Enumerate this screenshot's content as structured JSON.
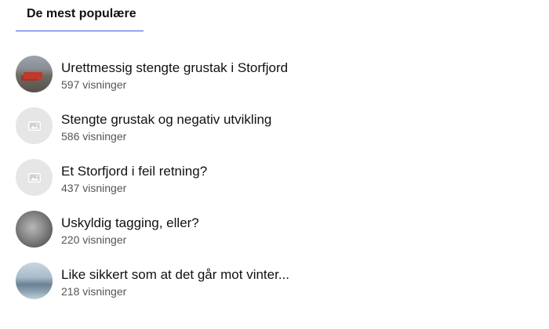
{
  "header": {
    "tab_label": "De mest populære"
  },
  "items": [
    {
      "title": "Urettmessig stengte grustak i Storfjord",
      "views": "597 visninger",
      "thumbnail": "photo"
    },
    {
      "title": "Stengte grustak og negativ utvikling",
      "views": "586 visninger",
      "thumbnail": "image-placeholder-icon"
    },
    {
      "title": "Et Storfjord i feil retning?",
      "views": "437 visninger",
      "thumbnail": "image-placeholder-icon"
    },
    {
      "title": "Uskyldig tagging, eller?",
      "views": "220 visninger",
      "thumbnail": "photo"
    },
    {
      "title": "Like sikkert som at det går mot vinter...",
      "views": "218 visninger",
      "thumbnail": "photo"
    }
  ],
  "colors": {
    "tab_underline": "#3b5bdb",
    "placeholder_bg": "#e6e6e6"
  }
}
